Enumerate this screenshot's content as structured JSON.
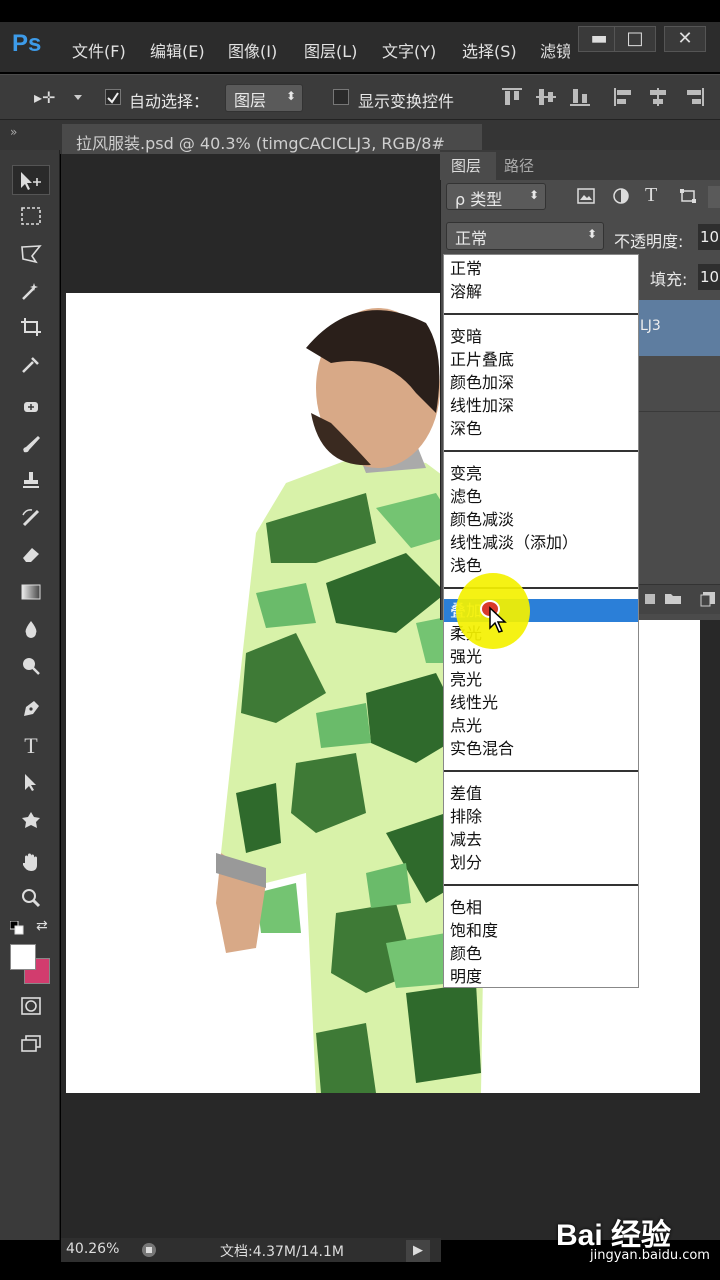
{
  "app": {
    "logo": "Ps"
  },
  "menu": [
    "文件(F)",
    "编辑(E)",
    "图像(I)",
    "图层(L)",
    "文字(Y)",
    "选择(S)",
    "滤镜"
  ],
  "window_controls": {
    "minimize": "▬",
    "restore": "□",
    "close": "✕"
  },
  "options_bar": {
    "move_tool": "▸✛",
    "auto_select_label": "自动选择：",
    "auto_select_value": "图层",
    "show_transform_label": "显示变换控件"
  },
  "document_tab": "拉风服装.psd @ 40.3% (timgCACICLJ3, RGB/8#",
  "layers_panel": {
    "tabs": [
      "图层",
      "路径"
    ],
    "filter_label": "ρ 类型",
    "blend_mode": "正常",
    "opacity_label": "不透明度:",
    "opacity_value": "10",
    "fill_label": "填充:",
    "fill_value": "10",
    "layer_name_fragment": "LJ3"
  },
  "blend_groups": [
    [
      "正常",
      "溶解"
    ],
    [
      "变暗",
      "正片叠底",
      "颜色加深",
      "线性加深",
      "深色"
    ],
    [
      "变亮",
      "滤色",
      "颜色减淡",
      "线性减淡（添加）",
      "浅色"
    ],
    [
      "叠加",
      "柔光",
      "强光",
      "亮光",
      "线性光",
      "点光",
      "实色混合"
    ],
    [
      "差值",
      "排除",
      "减去",
      "划分"
    ],
    [
      "色相",
      "饱和度",
      "颜色",
      "明度"
    ]
  ],
  "selected_blend": "叠加",
  "status": {
    "zoom": "40.26%",
    "doc": "文档:4.37M/14.1M"
  },
  "watermark": {
    "brand": "Bai 经验",
    "url": "jingyan.baidu.com"
  },
  "colors": {
    "accent": "#3d9be9",
    "highlight": "#2b7fd8",
    "foreground": "#ffffff",
    "background": "#d23c6e",
    "cursor_marker": "#f4f100"
  }
}
